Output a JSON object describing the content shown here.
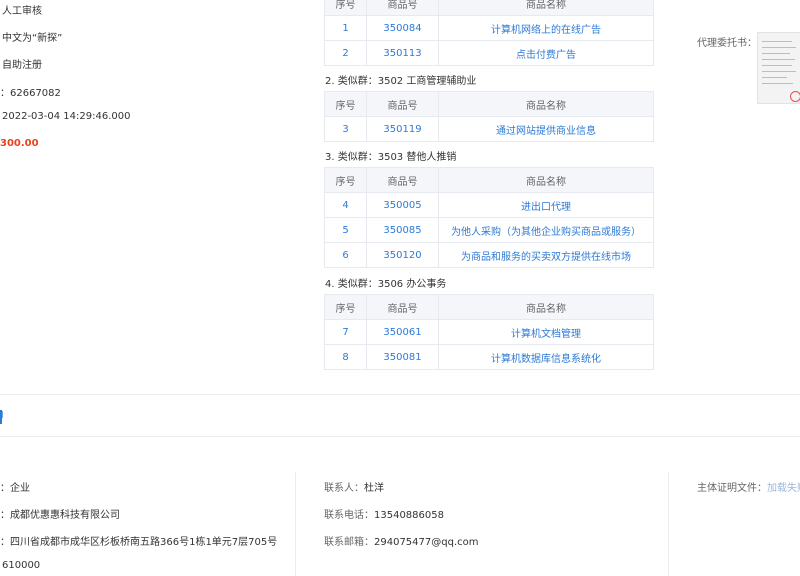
{
  "left_info": {
    "review_type": "人工审核",
    "chinese_meaning": "中文为“新探”",
    "register_method": "自助注册",
    "order_id": "：62667082",
    "datetime": "2022-03-04 14:29:46.000",
    "price": "300.00"
  },
  "goods_table": {
    "headers": {
      "index": "序号",
      "code": "商品号",
      "name": "商品名称"
    },
    "group1_rows": [
      {
        "index": "1",
        "code": "350084",
        "name": "计算机网络上的在线广告"
      },
      {
        "index": "2",
        "code": "350113",
        "name": "点击付费广告"
      }
    ],
    "group2_title": "2. 类似群：3502 工商管理辅助业",
    "group2_rows": [
      {
        "index": "3",
        "code": "350119",
        "name": "通过网站提供商业信息"
      }
    ],
    "group3_title": "3. 类似群：3503 替他人推销",
    "group3_rows": [
      {
        "index": "4",
        "code": "350005",
        "name": "进出口代理"
      },
      {
        "index": "5",
        "code": "350085",
        "name": "为他人采购（为其他企业购买商品或服务）"
      },
      {
        "index": "6",
        "code": "350120",
        "name": "为商品和服务的买卖双方提供在线市场"
      }
    ],
    "group4_title": "4. 类似群：3506 办公事务",
    "group4_rows": [
      {
        "index": "7",
        "code": "350061",
        "name": "计算机文档管理"
      },
      {
        "index": "8",
        "code": "350081",
        "name": "计算机数据库信息系统化"
      }
    ]
  },
  "agent_letter": {
    "label": "代理委托书："
  },
  "section_marker": "l",
  "applicant": {
    "type": "：企业",
    "company": "：成都优惠惠科技有限公司",
    "address": "：四川省成都市成华区杉板桥南五路366号1栋1单元7层705号",
    "postcode": "610000"
  },
  "contact": {
    "person_label": "联系人：",
    "person_value": "杜洋",
    "phone_label": "联系电话：",
    "phone_value": "13540886058",
    "email_label": "联系邮箱：",
    "email_value": "294075477@qq.com"
  },
  "subject_doc": {
    "label": "主体证明文件：",
    "link": "加载失败"
  }
}
